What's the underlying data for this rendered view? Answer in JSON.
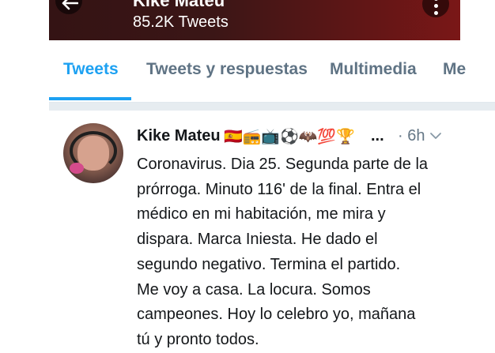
{
  "header": {
    "name": "Kike Mateu",
    "tweet_count": "85.2K Tweets",
    "colors": {
      "accent": "#1da1f2"
    }
  },
  "tabs": [
    {
      "label": "Tweets",
      "active": true
    },
    {
      "label": "Tweets y respuestas"
    },
    {
      "label": "Multimedia"
    },
    {
      "label": "Me"
    }
  ],
  "tweet": {
    "user_name": "Kike Mateu",
    "emojis": "🇪🇸📻📺⚽🦇💯🏆",
    "ellipsis": "...",
    "time": "· 6h",
    "lines": [
      "Coronavirus. Dia 25. Segunda parte de la",
      "prórroga. Minuto 116' de la final. Entra el",
      "médico en mi habitación, me mira y",
      "dispara. Marca Iniesta. He dado el",
      "segundo negativo. Termina el partido.",
      "Me voy a casa. La locura. Somos",
      "campeones. Hoy lo celebro yo, mañana",
      "tú y pronto todos."
    ]
  },
  "icons": {
    "back": "arrow-left-icon",
    "more": "more-vertical-icon",
    "caret": "chevron-down-icon"
  }
}
